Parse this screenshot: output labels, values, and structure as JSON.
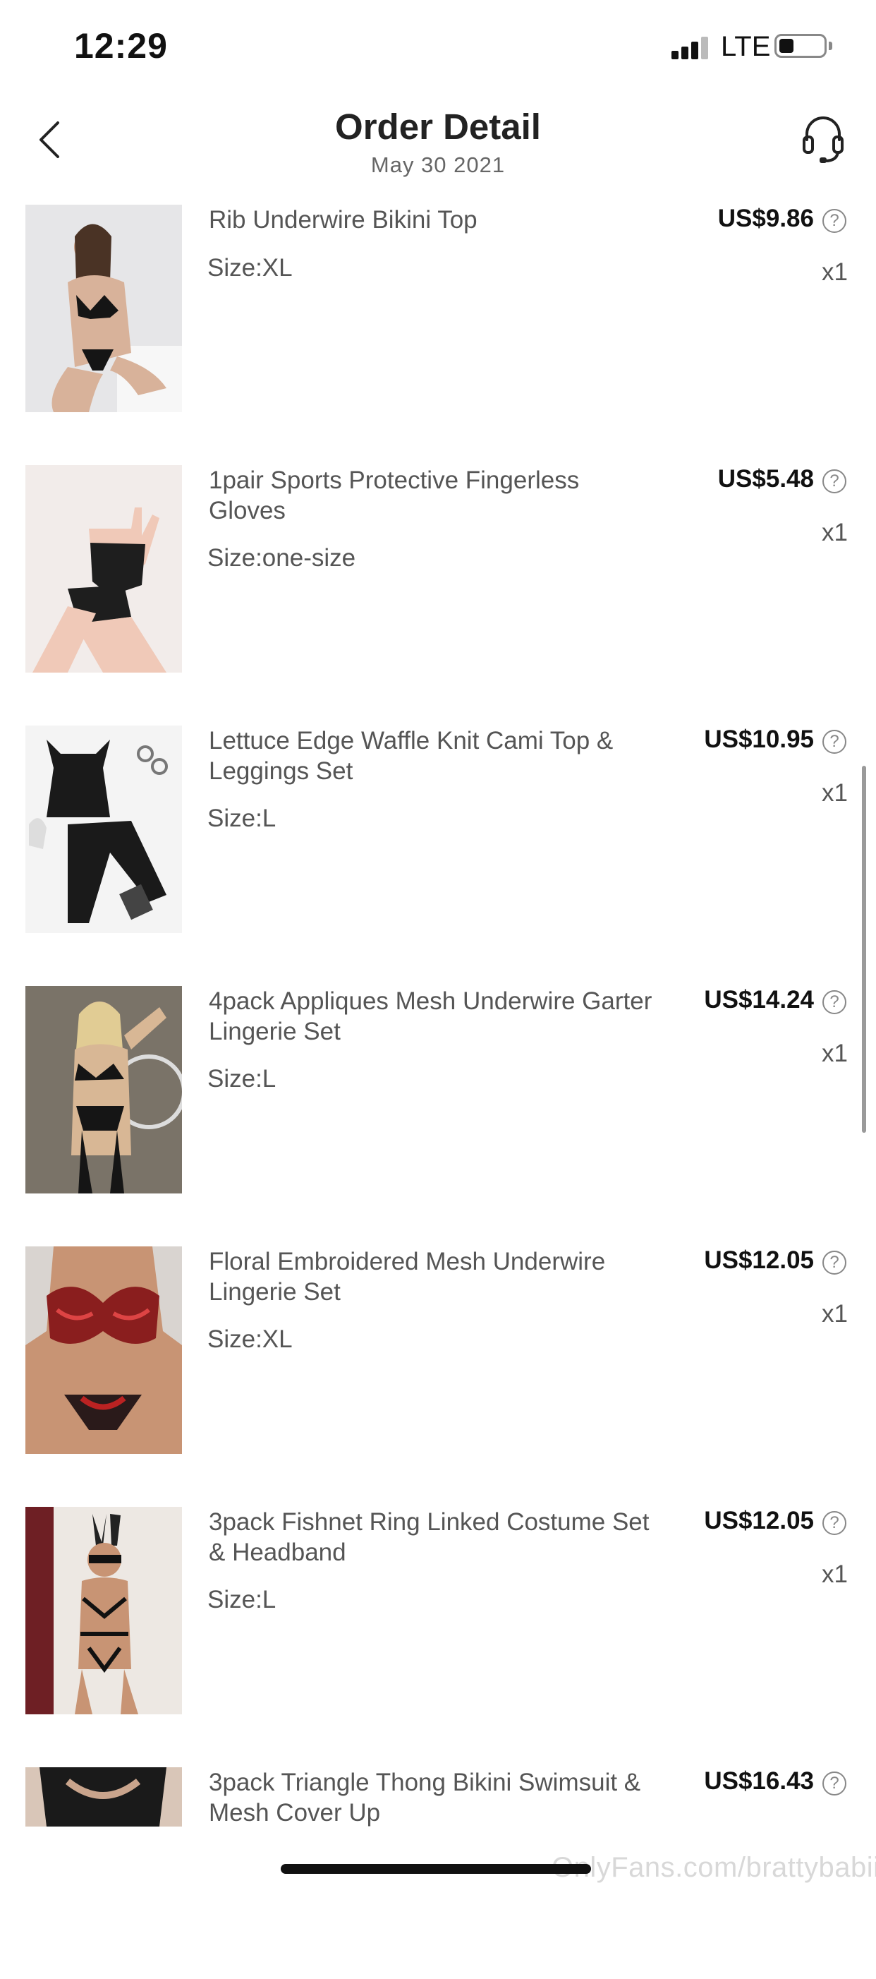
{
  "status_bar": {
    "time": "12:29",
    "network": "LTE",
    "signal_icon": "signal-bars-icon",
    "battery_icon": "battery-icon"
  },
  "header": {
    "title": "Order Detail",
    "date": "May 30 2021",
    "back_icon": "chevron-left-icon",
    "support_icon": "headset-icon"
  },
  "items": [
    {
      "name": "Rib Underwire Bikini Top",
      "size": "Size:XL",
      "price": "US$9.86",
      "qty": "x1"
    },
    {
      "name": "1pair Sports Protective Fingerless Gloves",
      "size": "Size:one-size",
      "price": "US$5.48",
      "qty": "x1"
    },
    {
      "name": "Lettuce Edge Waffle Knit Cami Top & Leggings Set",
      "size": "Size:L",
      "price": "US$10.95",
      "qty": "x1"
    },
    {
      "name": "4pack Appliques Mesh Underwire Garter Lingerie Set",
      "size": "Size:L",
      "price": "US$14.24",
      "qty": "x1"
    },
    {
      "name": "Floral Embroidered Mesh Underwire Lingerie Set",
      "size": "Size:XL",
      "price": "US$12.05",
      "qty": "x1"
    },
    {
      "name": "3pack Fishnet Ring Linked Costume Set & Headband",
      "size": "Size:L",
      "price": "US$12.05",
      "qty": "x1"
    },
    {
      "name": "3pack Triangle Thong Bikini Swimsuit & Mesh Cover Up",
      "size": "",
      "price": "US$16.43",
      "qty": ""
    }
  ],
  "help_glyph": "?",
  "watermark": "OnlyFans.com/brattybabiii"
}
